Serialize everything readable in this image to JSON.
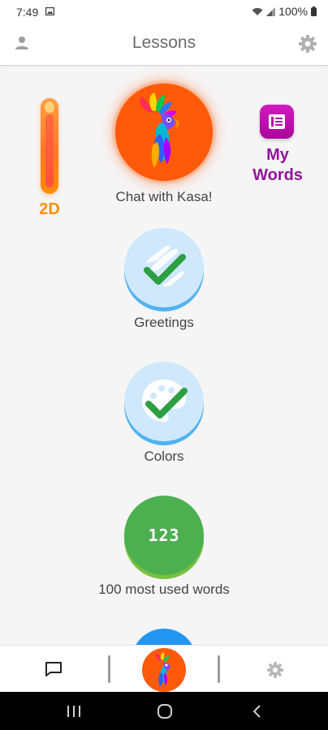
{
  "status": {
    "time": "7:49",
    "battery": "100%"
  },
  "header": {
    "title": "Lessons"
  },
  "streak": {
    "label": "2D"
  },
  "kasa": {
    "label": "Chat with Kasa!"
  },
  "my_words": {
    "label_line1": "My",
    "label_line2": "Words"
  },
  "lessons": [
    {
      "label": "Greetings",
      "color": "#cfe8fb"
    },
    {
      "label": "Colors",
      "color": "#cfe8fb"
    },
    {
      "label": "100 most used words",
      "badge": "123",
      "color": "#4caf50"
    }
  ],
  "colors": {
    "kasa_orange": "#ff5a0a",
    "streak_orange": "#ff8f00",
    "my_words_purple": "#93139c",
    "lesson_blue": "#4fb3ef",
    "lesson_green": "#4caf50"
  }
}
